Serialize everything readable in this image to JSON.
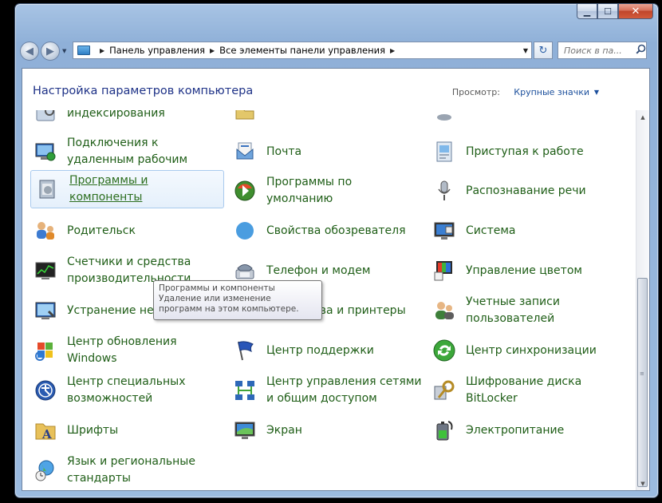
{
  "window": {
    "controls": {
      "minimize": "▁",
      "maximize": "☐",
      "close": "✕"
    }
  },
  "nav": {
    "back_icon": "◀",
    "forward_icon": "▶",
    "history_icon": "▼",
    "breadcrumb": [
      "Панель управления",
      "Все элементы панели управления"
    ],
    "refresh_icon": "↻",
    "search_placeholder": "Поиск в па...",
    "search_icon": "⌕"
  },
  "header": {
    "title": "Настройка параметров компьютера",
    "view_label": "Просмотр:",
    "view_value": "Крупные значки"
  },
  "items": {
    "col1": [
      {
        "label": "индексирования",
        "icon": "indexing-icon"
      },
      {
        "label": "Подключения к\nудаленным рабочим",
        "icon": "remote-desktop-icon"
      },
      {
        "label": "Программы и\nкомпоненты",
        "icon": "programs-features-icon",
        "selected": true
      },
      {
        "label": "Родительский контроль",
        "icon": "parental-controls-icon"
      },
      {
        "label": "Счетчики и средства\nпроизводительности",
        "icon": "performance-icon"
      },
      {
        "label": "Устранение неполадок",
        "icon": "troubleshooting-icon"
      },
      {
        "label": "Центр обновления\nWindows",
        "icon": "windows-update-icon"
      },
      {
        "label": "Центр специальных\nвозможностей",
        "icon": "ease-of-access-icon"
      },
      {
        "label": "Шрифты",
        "icon": "fonts-icon"
      },
      {
        "label": "Язык и региональные\nстандарты",
        "icon": "region-language-icon"
      }
    ],
    "col2": [
      {
        "label": "",
        "icon": "folder-icon"
      },
      {
        "label": "Почта",
        "icon": "mail-icon"
      },
      {
        "label": "Программы по\nумолчанию",
        "icon": "default-programs-icon"
      },
      {
        "label": "Свойства обозревателя",
        "icon": "internet-options-icon"
      },
      {
        "label": "Телефон и модем",
        "icon": "phone-modem-icon"
      },
      {
        "label": "Устройства и принтеры",
        "icon": "devices-printers-icon"
      },
      {
        "label": "Центр поддержки",
        "icon": "action-center-icon"
      },
      {
        "label": "Центр управления сетями\nи общим доступом",
        "icon": "network-center-icon"
      },
      {
        "label": "Экран",
        "icon": "display-icon"
      }
    ],
    "col3": [
      {
        "label": "",
        "icon": "partial-icon"
      },
      {
        "label": "Приступая к работе",
        "icon": "getting-started-icon"
      },
      {
        "label": "Распознавание речи",
        "icon": "speech-recognition-icon"
      },
      {
        "label": "Система",
        "icon": "system-icon"
      },
      {
        "label": "Управление цветом",
        "icon": "color-management-icon"
      },
      {
        "label": "Учетные записи\nпользователей",
        "icon": "user-accounts-icon"
      },
      {
        "label": "Центр синхронизации",
        "icon": "sync-center-icon"
      },
      {
        "label": "Шифрование диска\nBitLocker",
        "icon": "bitlocker-icon"
      },
      {
        "label": "Электропитание",
        "icon": "power-options-icon"
      }
    ]
  },
  "tooltip": {
    "title": "Программы и компоненты",
    "description": "Удаление или изменение программ на этом компьютере."
  },
  "scrollbar": {
    "up_icon": "▲",
    "down_icon": "▼"
  }
}
